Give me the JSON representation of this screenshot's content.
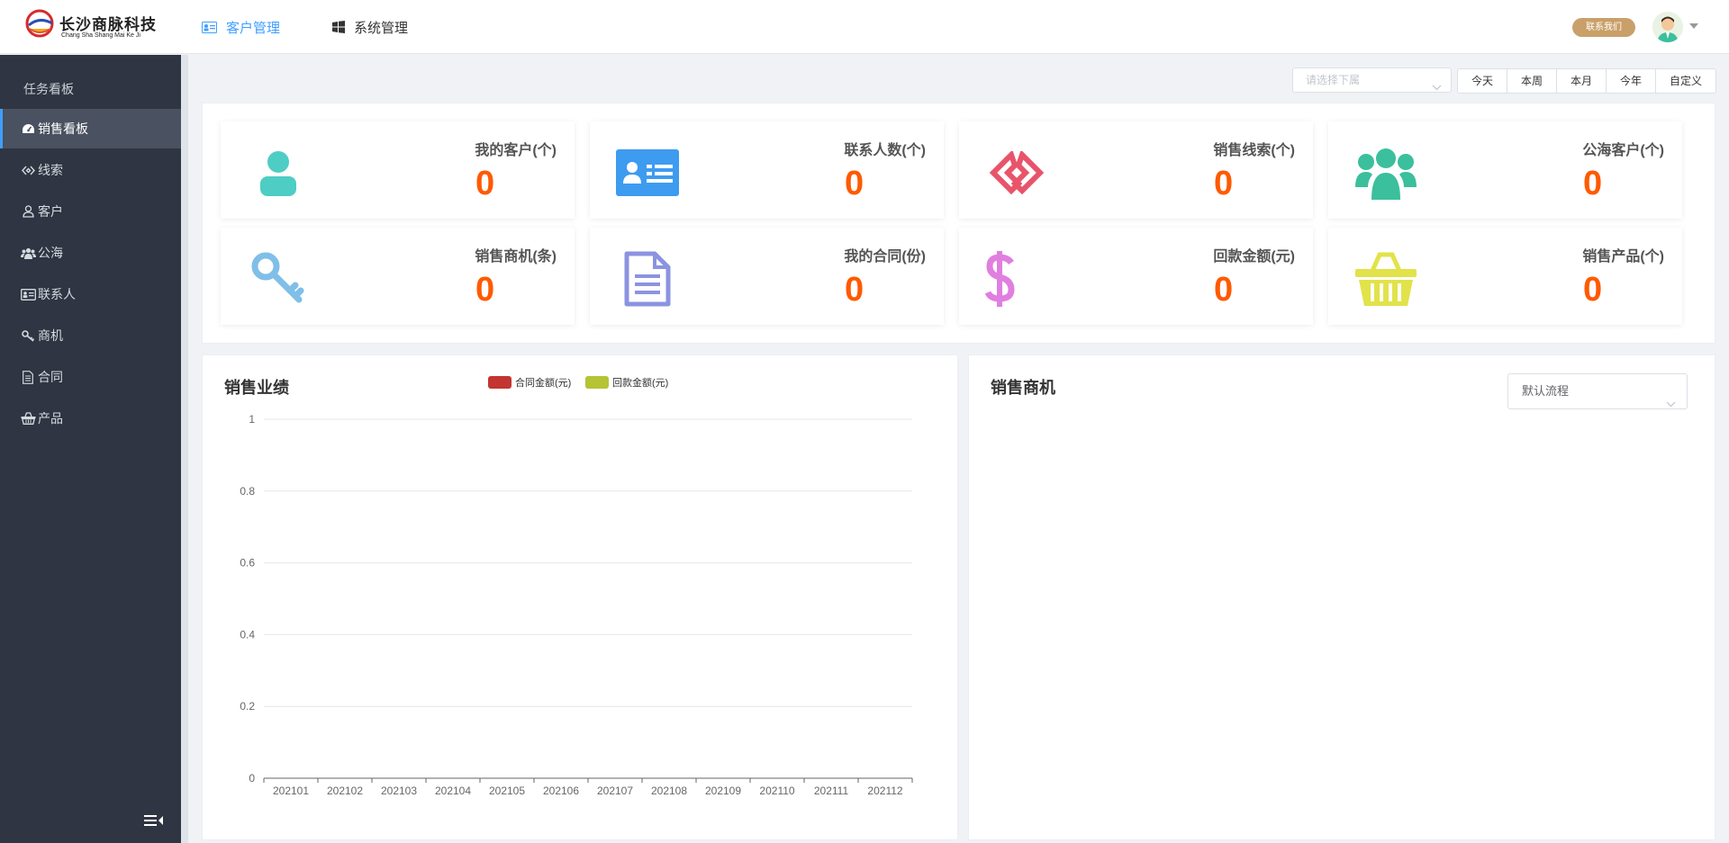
{
  "header": {
    "logo_text": "长沙商脉科技",
    "logo_sub": "Chang Sha Shang Mai Ke Ji",
    "nav": [
      {
        "label": "客户管理",
        "icon": "id-card-icon",
        "active": true
      },
      {
        "label": "系统管理",
        "icon": "windows-icon",
        "active": false
      }
    ],
    "contact_label": "联系我们"
  },
  "sidebar": {
    "section_title": "任务看板",
    "items": [
      {
        "label": "销售看板",
        "icon": "dashboard-icon",
        "active": true
      },
      {
        "label": "线索",
        "icon": "clue-icon"
      },
      {
        "label": "客户",
        "icon": "user-icon"
      },
      {
        "label": "公海",
        "icon": "users-icon"
      },
      {
        "label": "联系人",
        "icon": "contact-card-icon"
      },
      {
        "label": "商机",
        "icon": "key-icon"
      },
      {
        "label": "合同",
        "icon": "document-icon"
      },
      {
        "label": "产品",
        "icon": "basket-icon"
      }
    ]
  },
  "filters": {
    "subordinate_placeholder": "请选择下属",
    "ranges": [
      "今天",
      "本周",
      "本月",
      "今年",
      "自定义"
    ]
  },
  "stats": [
    {
      "label": "我的客户(个)",
      "value": "0",
      "icon": "user-icon",
      "color": "#4ecdc4"
    },
    {
      "label": "联系人数(个)",
      "value": "0",
      "icon": "contact-card-icon",
      "color": "#3d9bf0"
    },
    {
      "label": "销售线索(个)",
      "value": "0",
      "icon": "clue-icon",
      "color": "#e8546a"
    },
    {
      "label": "公海客户(个)",
      "value": "0",
      "icon": "users-icon",
      "color": "#3bbf9c"
    },
    {
      "label": "销售商机(条)",
      "value": "0",
      "icon": "key-icon",
      "color": "#7fbfe8"
    },
    {
      "label": "我的合同(份)",
      "value": "0",
      "icon": "document-icon",
      "color": "#8c93e0"
    },
    {
      "label": "回款金额(元)",
      "value": "0",
      "icon": "dollar-icon",
      "color": "#e07fe0"
    },
    {
      "label": "销售产品(个)",
      "value": "0",
      "icon": "basket-icon",
      "color": "#e2e24a"
    }
  ],
  "sales_performance": {
    "title": "销售业绩"
  },
  "sales_opportunity": {
    "title": "销售商机",
    "flow_select": "默认流程"
  },
  "chart_data": {
    "type": "bar",
    "categories": [
      "202101",
      "202102",
      "202103",
      "202104",
      "202105",
      "202106",
      "202107",
      "202108",
      "202109",
      "202110",
      "202111",
      "202112"
    ],
    "series": [
      {
        "name": "合同金额(元)",
        "color": "#c23531",
        "values": [
          0,
          0,
          0,
          0,
          0,
          0,
          0,
          0,
          0,
          0,
          0,
          0
        ]
      },
      {
        "name": "回款金额(元)",
        "color": "#b5c334",
        "values": [
          0,
          0,
          0,
          0,
          0,
          0,
          0,
          0,
          0,
          0,
          0,
          0
        ]
      }
    ],
    "yticks": [
      "0",
      "0.2",
      "0.4",
      "0.6",
      "0.8",
      "1"
    ],
    "ylim": [
      0,
      1
    ],
    "grid": true,
    "legend": "top-center"
  }
}
